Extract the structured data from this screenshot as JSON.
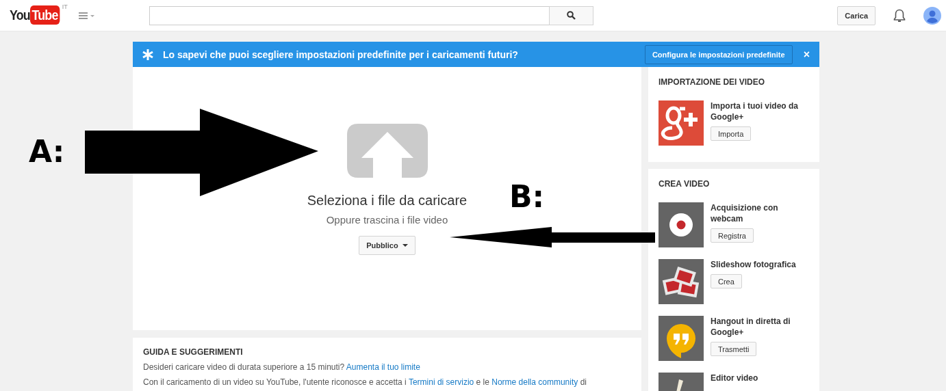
{
  "header": {
    "logo": {
      "part_1": "You",
      "part_2": "Tube",
      "country": "IT"
    },
    "upload_button": "Carica"
  },
  "banner": {
    "text": "Lo sapevi che puoi scegliere impostazioni predefinite per i caricamenti futuri?",
    "button": "Configura le impostazioni predefinite",
    "close": "×"
  },
  "upload": {
    "title": "Seleziona i file da caricare",
    "subtitle": "Oppure trascina i file video",
    "privacy": "Pubblico"
  },
  "guide": {
    "title": "GUIDA E SUGGERIMENTI",
    "lines": [
      {
        "segments": [
          {
            "kind": "text",
            "text": "Desideri caricare video di durata superiore a 15 minuti? "
          },
          {
            "kind": "link",
            "text": "Aumenta il tuo limite"
          }
        ]
      },
      {
        "segments": [
          {
            "kind": "text",
            "text": "Con il caricamento di un video su YouTube, l'utente riconosce e accetta i "
          },
          {
            "kind": "link",
            "text": "Termini di servizio"
          },
          {
            "kind": "text",
            "text": " e le "
          },
          {
            "kind": "link",
            "text": "Norme della community"
          },
          {
            "kind": "text",
            "text": " di"
          }
        ]
      }
    ]
  },
  "sidebar": [
    {
      "title": "IMPORTAZIONE DEI VIDEO",
      "items": [
        {
          "kind": "google-plus",
          "label": "Importa i tuoi video da Google+",
          "button": "Importa"
        }
      ]
    },
    {
      "title": "CREA VIDEO",
      "items": [
        {
          "kind": "webcam",
          "label": "Acquisizione con webcam",
          "button": "Registra"
        },
        {
          "kind": "slideshow",
          "label": "Slideshow fotografica",
          "button": "Crea"
        },
        {
          "kind": "hangout",
          "label": "Hangout in diretta di Google+",
          "button": "Trasmetti"
        },
        {
          "kind": "editor",
          "label": "Editor video"
        }
      ]
    }
  ],
  "annotations": [
    {
      "label": "A:"
    },
    {
      "label": "B:"
    }
  ]
}
